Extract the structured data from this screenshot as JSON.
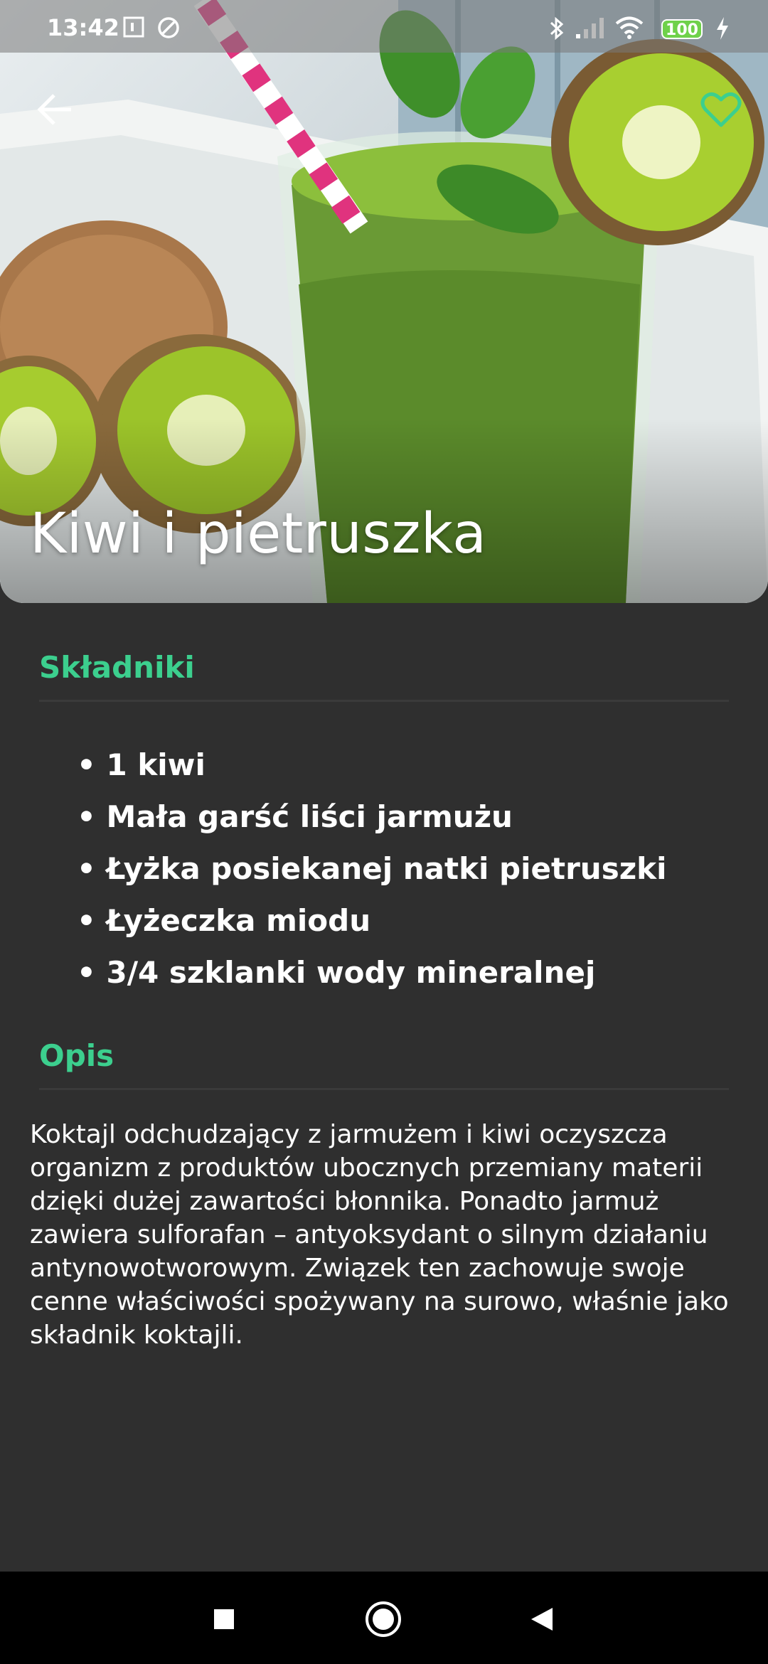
{
  "status_bar": {
    "time": "13:42",
    "battery": "100",
    "icons": [
      "sim-icon",
      "vpn-icon",
      "bluetooth-icon",
      "signal-icon",
      "wifi-icon",
      "battery-icon",
      "charging-icon"
    ]
  },
  "header": {
    "title": "Kiwi i pietruszka",
    "back_icon": "arrow-left-icon",
    "favorite_icon": "heart-outline-icon",
    "accent": "#3ccf8e"
  },
  "ingredients": {
    "title": "Składniki",
    "items": [
      "1 kiwi",
      "Mała garść liści jarmużu",
      "Łyżka posiekanej natki pietruszki",
      "Łyżeczka miodu",
      "3/4 szklanki wody mineralnej"
    ]
  },
  "description": {
    "title": "Opis",
    "text": "Koktajl odchudzający z jarmużem i kiwi oczyszcza organizm z produktów ubocznych przemiany materii dzięki dużej zawartości błonnika. Ponadto jarmuż zawiera sulforafan – antyoksydant o silnym działaniu antynowotworowym. Związek ten zachowuje swoje cenne właściwości spożywany na surowo, właśnie jako składnik koktajli."
  },
  "nav_bar": {
    "icons": [
      "recents-square-icon",
      "home-circle-icon",
      "back-triangle-icon"
    ]
  }
}
